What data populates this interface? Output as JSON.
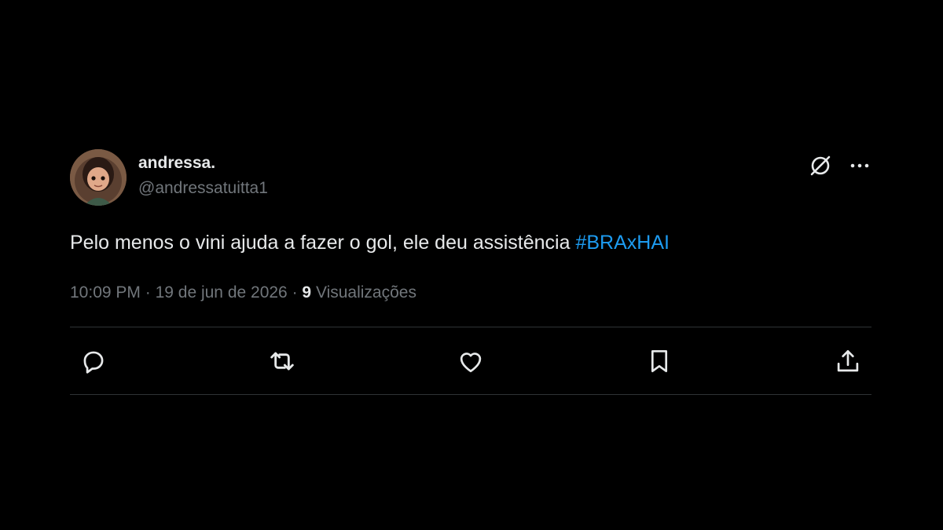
{
  "tweet": {
    "author": {
      "display_name": "andressa.",
      "handle": "@andressatuitta1",
      "avatar_icon": "avatar-cartoon-girl"
    },
    "text": "Pelo menos o vini ajuda a fazer o gol, ele deu assistência ",
    "hashtag": "#BRAxHAI",
    "time": "10:09 PM",
    "separator": "·",
    "date": "19 de jun de 2026",
    "views_count": "9",
    "views_label": "Visualizações"
  },
  "top_actions": {
    "grok_icon": "grok-icon",
    "more_icon": "more-icon"
  },
  "actions": [
    "reply-icon",
    "retweet-icon",
    "like-icon",
    "bookmark-icon",
    "share-icon"
  ],
  "colors": {
    "background": "#000000",
    "primary_text": "#e7e9ea",
    "secondary_text": "#71767b",
    "hashtag": "#1d9bf0",
    "divider": "#2f3336"
  }
}
